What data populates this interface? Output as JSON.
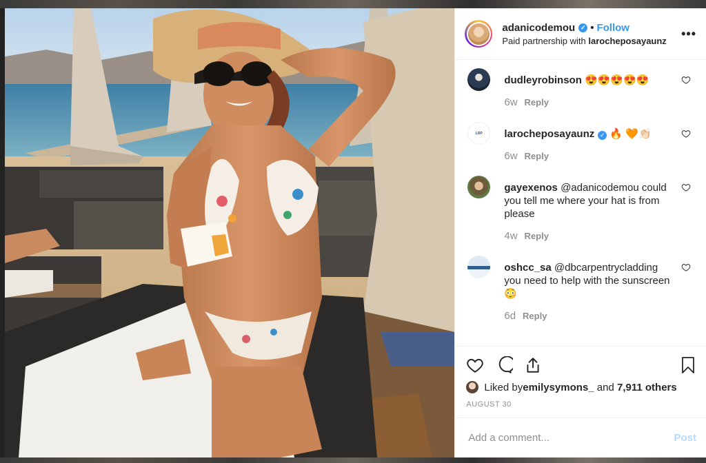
{
  "post": {
    "username": "adanicodemou",
    "follow_label": "Follow",
    "separator": "•",
    "partnership_prefix": "Paid partnership with ",
    "partner": "larocheposayaunz",
    "more_icon": "more-dots-icon"
  },
  "comments": [
    {
      "user": "dudleyrobinson",
      "text": " 😍😍😍😍😍",
      "age": "6w",
      "reply": "Reply",
      "verified": false
    },
    {
      "user": "larocheposayaunz",
      "text": " 🔥 🧡👏🏻",
      "age": "6w",
      "reply": "Reply",
      "verified": true
    },
    {
      "user": "gayexenos",
      "text": " @adanicodemou could you tell me where your hat is from please",
      "age": "4w",
      "reply": "Reply",
      "verified": false
    },
    {
      "user": "oshcc_sa",
      "text": " @dbcarpentrycladding you need to help with the sunscreen 😳",
      "age": "6d",
      "reply": "Reply",
      "verified": false
    }
  ],
  "likes": {
    "prefix": "Liked by ",
    "user": "emilysymons_",
    "middle": " and ",
    "count": "7,911 others"
  },
  "date": "AUGUST 30",
  "add_comment": {
    "placeholder": "Add a comment...",
    "post_label": "Post"
  },
  "colors": {
    "accent": "#3897f0",
    "text": "#262626",
    "muted": "#8e8e8e",
    "post_disabled": "#b3dbff"
  }
}
